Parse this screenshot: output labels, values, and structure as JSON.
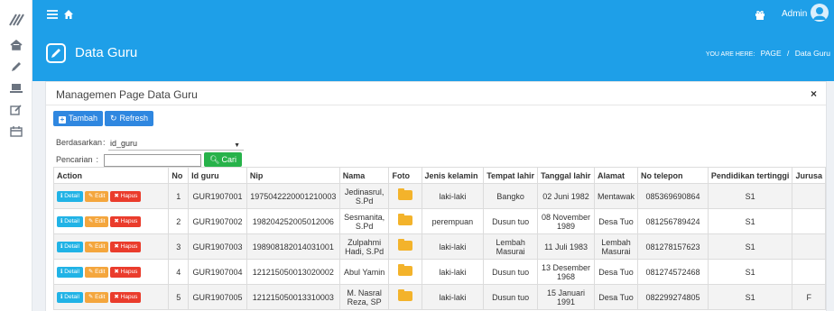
{
  "topbar": {
    "admin_name": "Admin"
  },
  "heading": {
    "page_title": "Data Guru",
    "breadcrumb_label": "YOU ARE HERE:",
    "breadcrumb_page": "PAGE",
    "breadcrumb_sep": "/",
    "breadcrumb_current": "Data Guru"
  },
  "card": {
    "title": "Managemen Page Data Guru",
    "close_glyph": "×",
    "tambah_label": "Tambah",
    "refresh_label": "Refresh",
    "filter_label": "Berdasarkan",
    "filter_colon": ":",
    "filter_value": "id_guru",
    "search_label": "Pencarian",
    "search_colon": ":",
    "search_value": "",
    "cari_label": "Cari"
  },
  "table": {
    "headers": [
      "Action",
      "No",
      "Id guru",
      "Nip",
      "Nama",
      "Foto",
      "Jenis kelamin",
      "Tempat lahir",
      "Tanggal lahir",
      "Alamat",
      "No telepon",
      "Pendidikan tertinggi",
      "Jurusa"
    ],
    "action_labels": {
      "detail": "Detail",
      "edit": "Edit",
      "hapus": "Hapus"
    },
    "rows": [
      {
        "no": "1",
        "id_guru": "GUR1907001",
        "nip": "1975042220001210003",
        "nama": "Jedinasrul, S.Pd",
        "jk": "laki-laki",
        "tempat": "Bangko",
        "tanggal": "02 Juni 1982",
        "alamat": "Mentawak",
        "telepon": "085369690864",
        "pendidikan": "S1",
        "jurusan": ""
      },
      {
        "no": "2",
        "id_guru": "GUR1907002",
        "nip": "198204252005012006",
        "nama": "Sesmanita, S.Pd",
        "jk": "perempuan",
        "tempat": "Dusun tuo",
        "tanggal": "08 November 1989",
        "alamat": "Desa Tuo",
        "telepon": "081256789424",
        "pendidikan": "S1",
        "jurusan": ""
      },
      {
        "no": "3",
        "id_guru": "GUR1907003",
        "nip": "198908182014031001",
        "nama": "Zulpahmi Hadi, S.Pd",
        "jk": "laki-laki",
        "tempat": "Lembah Masurai",
        "tanggal": "11 Juli 1983",
        "alamat": "Lembah Masurai",
        "telepon": "081278157623",
        "pendidikan": "S1",
        "jurusan": ""
      },
      {
        "no": "4",
        "id_guru": "GUR1907004",
        "nip": "121215050013020002",
        "nama": "Abul Yamin",
        "jk": "laki-laki",
        "tempat": "Dusun tuo",
        "tanggal": "13 Desember 1968",
        "alamat": "Desa Tuo",
        "telepon": "081274572468",
        "pendidikan": "S1",
        "jurusan": ""
      },
      {
        "no": "5",
        "id_guru": "GUR1907005",
        "nip": "121215050013310003",
        "nama": "M. Nasral Reza, SP",
        "jk": "laki-laki",
        "tempat": "Dusun tuo",
        "tanggal": "15 Januari 1991",
        "alamat": "Desa Tuo",
        "telepon": "082299274805",
        "pendidikan": "S1",
        "jurusan": "F"
      }
    ]
  },
  "colors": {
    "primary": "#1e9fe8",
    "detail": "#21b3e6",
    "edit": "#f4a63d",
    "hapus": "#ea3c2c",
    "cari": "#27b24a"
  },
  "icons": [
    "logo-icon",
    "home-icon",
    "pencil-icon",
    "laptop-icon",
    "edit-icon",
    "calendar-icon",
    "menu-icon",
    "gift-icon",
    "avatar",
    "plus-icon",
    "refresh-icon",
    "search-icon",
    "info-icon",
    "trash-icon",
    "folder-icon"
  ]
}
